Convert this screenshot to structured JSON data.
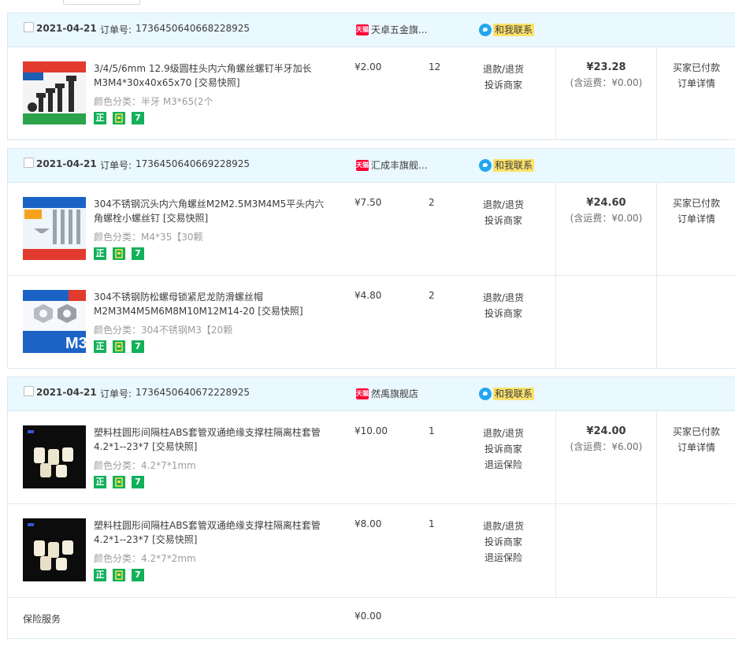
{
  "colors": {
    "header_bg": "#eaf8ff",
    "border": "#d8e8f2",
    "badge_green": "#12b05a",
    "contact_yellow": "#fbe26b",
    "tmall_red": "#ff0036"
  },
  "labels": {
    "order_no": "订单号:",
    "contact": "和我联系",
    "refund": "退款/退货",
    "complain": "投诉商家",
    "return_ins": "退运保险",
    "shipping_prefix": "(含运费：",
    "shipping_suffix": ")",
    "status_paid": "买家已付款",
    "order_detail": "订单详情",
    "badge_zheng": "正",
    "badge_seven": "7",
    "tmall_icon": "天猫"
  },
  "orders": [
    {
      "date": "2021-04-21",
      "order_no": "1736450640668228925",
      "shop": "天卓五金旗...",
      "total": "¥23.28",
      "shipping": "(含运费：¥0.00)",
      "items": [
        {
          "title": "3/4/5/6mm 12.9级圆柱头内六角螺丝螺钉半牙加长M3M4*30x40x65x70 [交易快照]",
          "sku": "颜色分类：半牙 M3*65(2个",
          "price": "¥2.00",
          "qty": "12"
        }
      ]
    },
    {
      "date": "2021-04-21",
      "order_no": "1736450640669228925",
      "shop": "汇成丰旗舰...",
      "total": "¥24.60",
      "shipping": "(含运费：¥0.00)",
      "items": [
        {
          "title": "304不锈钢沉头内六角螺丝M2M2.5M3M4M5平头内六角螺栓小螺丝钉 [交易快照]",
          "sku": "颜色分类：M4*35【30颗",
          "price": "¥7.50",
          "qty": "2"
        },
        {
          "title": "304不锈钢防松螺母锁紧尼龙防滑螺丝帽M2M3M4M5M6M8M10M12M14-20 [交易快照]",
          "sku": "颜色分类：304不锈钢M3【20颗",
          "price": "¥4.80",
          "qty": "2"
        }
      ]
    },
    {
      "date": "2021-04-21",
      "order_no": "1736450640672228925",
      "shop": "然禹旗舰店",
      "total": "¥24.00",
      "shipping": "(含运费：¥6.00)",
      "items": [
        {
          "title": "塑料柱圆形间隔柱ABS套管双通绝缘支撑柱隔离柱套管4.2*1--23*7 [交易快照]",
          "sku": "颜色分类：4.2*7*1mm",
          "price": "¥10.00",
          "qty": "1"
        },
        {
          "title": "塑料柱圆形间隔柱ABS套管双通绝缘支撑柱隔离柱套管4.2*1--23*7 [交易快照]",
          "sku": "颜色分类：4.2*7*2mm",
          "price": "¥8.00",
          "qty": "1"
        }
      ],
      "insurance": {
        "label": "保险服务",
        "price": "¥0.00"
      }
    }
  ]
}
